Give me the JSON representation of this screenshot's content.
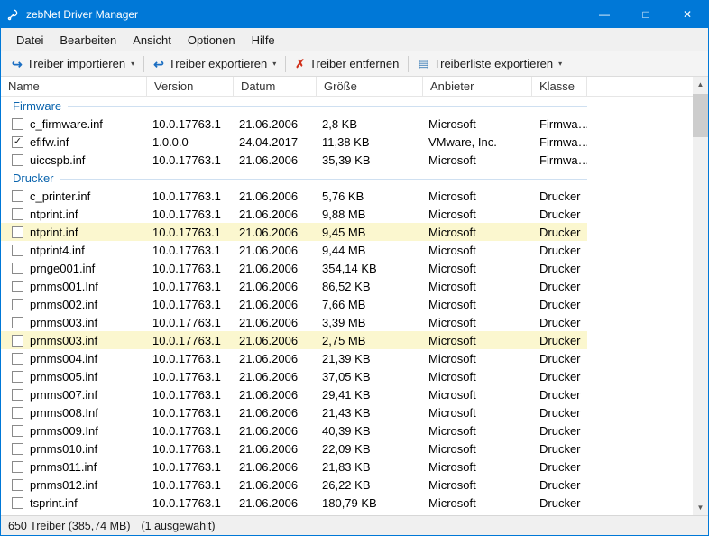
{
  "window": {
    "title": "zebNet Driver Manager",
    "controls": {
      "minimize": "—",
      "maximize": "□",
      "close": "✕"
    }
  },
  "colors": {
    "titlebar": "#0078d7",
    "group_label": "#0a64ad",
    "row_highlight": "#fbf7cf",
    "remove_icon_red": "#d12f19",
    "toolbar_icon_blue": "#1b6ec2"
  },
  "menu": {
    "items": [
      "Datei",
      "Bearbeiten",
      "Ansicht",
      "Optionen",
      "Hilfe"
    ]
  },
  "toolbar": {
    "caret_glyph": "▾",
    "buttons": [
      {
        "label": "Treiber importieren",
        "icon": "import-arrow-icon",
        "glyph": "↪",
        "dropdown": true
      },
      {
        "label": "Treiber exportieren",
        "icon": "export-arrow-icon",
        "glyph": "↩",
        "dropdown": true
      },
      {
        "label": "Treiber entfernen",
        "icon": "remove-x-icon",
        "glyph": "✗",
        "dropdown": false
      },
      {
        "label": "Treiberliste exportieren",
        "icon": "list-icon",
        "glyph": "▤",
        "dropdown": true
      }
    ]
  },
  "table": {
    "check_glyph": "✓",
    "columns": [
      "Name",
      "Version",
      "Datum",
      "Größe",
      "Anbieter",
      "Klasse"
    ],
    "groups": [
      {
        "label": "Firmware",
        "rows": [
          {
            "name": "c_firmware.inf",
            "version": "10.0.17763.1",
            "date": "21.06.2006",
            "size": "2,8 KB",
            "vendor": "Microsoft",
            "klass": "Firmwa…",
            "checked": false,
            "highlighted": false
          },
          {
            "name": "efifw.inf",
            "version": "1.0.0.0",
            "date": "24.04.2017",
            "size": "11,38 KB",
            "vendor": "VMware, Inc.",
            "klass": "Firmwa…",
            "checked": true,
            "highlighted": false
          },
          {
            "name": "uiccspb.inf",
            "version": "10.0.17763.1",
            "date": "21.06.2006",
            "size": "35,39 KB",
            "vendor": "Microsoft",
            "klass": "Firmwa…",
            "checked": false,
            "highlighted": false
          }
        ]
      },
      {
        "label": "Drucker",
        "rows": [
          {
            "name": "c_printer.inf",
            "version": "10.0.17763.1",
            "date": "21.06.2006",
            "size": "5,76 KB",
            "vendor": "Microsoft",
            "klass": "Drucker",
            "checked": false,
            "highlighted": false
          },
          {
            "name": "ntprint.inf",
            "version": "10.0.17763.1",
            "date": "21.06.2006",
            "size": "9,88 MB",
            "vendor": "Microsoft",
            "klass": "Drucker",
            "checked": false,
            "highlighted": false
          },
          {
            "name": "ntprint.inf",
            "version": "10.0.17763.1",
            "date": "21.06.2006",
            "size": "9,45 MB",
            "vendor": "Microsoft",
            "klass": "Drucker",
            "checked": false,
            "highlighted": true
          },
          {
            "name": "ntprint4.inf",
            "version": "10.0.17763.1",
            "date": "21.06.2006",
            "size": "9,44 MB",
            "vendor": "Microsoft",
            "klass": "Drucker",
            "checked": false,
            "highlighted": false
          },
          {
            "name": "prnge001.inf",
            "version": "10.0.17763.1",
            "date": "21.06.2006",
            "size": "354,14 KB",
            "vendor": "Microsoft",
            "klass": "Drucker",
            "checked": false,
            "highlighted": false
          },
          {
            "name": "prnms001.Inf",
            "version": "10.0.17763.1",
            "date": "21.06.2006",
            "size": "86,52 KB",
            "vendor": "Microsoft",
            "klass": "Drucker",
            "checked": false,
            "highlighted": false
          },
          {
            "name": "prnms002.inf",
            "version": "10.0.17763.1",
            "date": "21.06.2006",
            "size": "7,66 MB",
            "vendor": "Microsoft",
            "klass": "Drucker",
            "checked": false,
            "highlighted": false
          },
          {
            "name": "prnms003.inf",
            "version": "10.0.17763.1",
            "date": "21.06.2006",
            "size": "3,39 MB",
            "vendor": "Microsoft",
            "klass": "Drucker",
            "checked": false,
            "highlighted": false
          },
          {
            "name": "prnms003.inf",
            "version": "10.0.17763.1",
            "date": "21.06.2006",
            "size": "2,75 MB",
            "vendor": "Microsoft",
            "klass": "Drucker",
            "checked": false,
            "highlighted": true
          },
          {
            "name": "prnms004.inf",
            "version": "10.0.17763.1",
            "date": "21.06.2006",
            "size": "21,39 KB",
            "vendor": "Microsoft",
            "klass": "Drucker",
            "checked": false,
            "highlighted": false
          },
          {
            "name": "prnms005.inf",
            "version": "10.0.17763.1",
            "date": "21.06.2006",
            "size": "37,05 KB",
            "vendor": "Microsoft",
            "klass": "Drucker",
            "checked": false,
            "highlighted": false
          },
          {
            "name": "prnms007.inf",
            "version": "10.0.17763.1",
            "date": "21.06.2006",
            "size": "29,41 KB",
            "vendor": "Microsoft",
            "klass": "Drucker",
            "checked": false,
            "highlighted": false
          },
          {
            "name": "prnms008.Inf",
            "version": "10.0.17763.1",
            "date": "21.06.2006",
            "size": "21,43 KB",
            "vendor": "Microsoft",
            "klass": "Drucker",
            "checked": false,
            "highlighted": false
          },
          {
            "name": "prnms009.Inf",
            "version": "10.0.17763.1",
            "date": "21.06.2006",
            "size": "40,39 KB",
            "vendor": "Microsoft",
            "klass": "Drucker",
            "checked": false,
            "highlighted": false
          },
          {
            "name": "prnms010.inf",
            "version": "10.0.17763.1",
            "date": "21.06.2006",
            "size": "22,09 KB",
            "vendor": "Microsoft",
            "klass": "Drucker",
            "checked": false,
            "highlighted": false
          },
          {
            "name": "prnms011.inf",
            "version": "10.0.17763.1",
            "date": "21.06.2006",
            "size": "21,83 KB",
            "vendor": "Microsoft",
            "klass": "Drucker",
            "checked": false,
            "highlighted": false
          },
          {
            "name": "prnms012.inf",
            "version": "10.0.17763.1",
            "date": "21.06.2006",
            "size": "26,22 KB",
            "vendor": "Microsoft",
            "klass": "Drucker",
            "checked": false,
            "highlighted": false
          },
          {
            "name": "tsprint.inf",
            "version": "10.0.17763.1",
            "date": "21.06.2006",
            "size": "180,79 KB",
            "vendor": "Microsoft",
            "klass": "Drucker",
            "checked": false,
            "highlighted": false
          }
        ]
      }
    ]
  },
  "scrollbar": {
    "up_glyph": "▲",
    "down_glyph": "▼"
  },
  "statusbar": {
    "counts": "650 Treiber (385,74 MB)",
    "selected": "(1 ausgewählt)"
  }
}
